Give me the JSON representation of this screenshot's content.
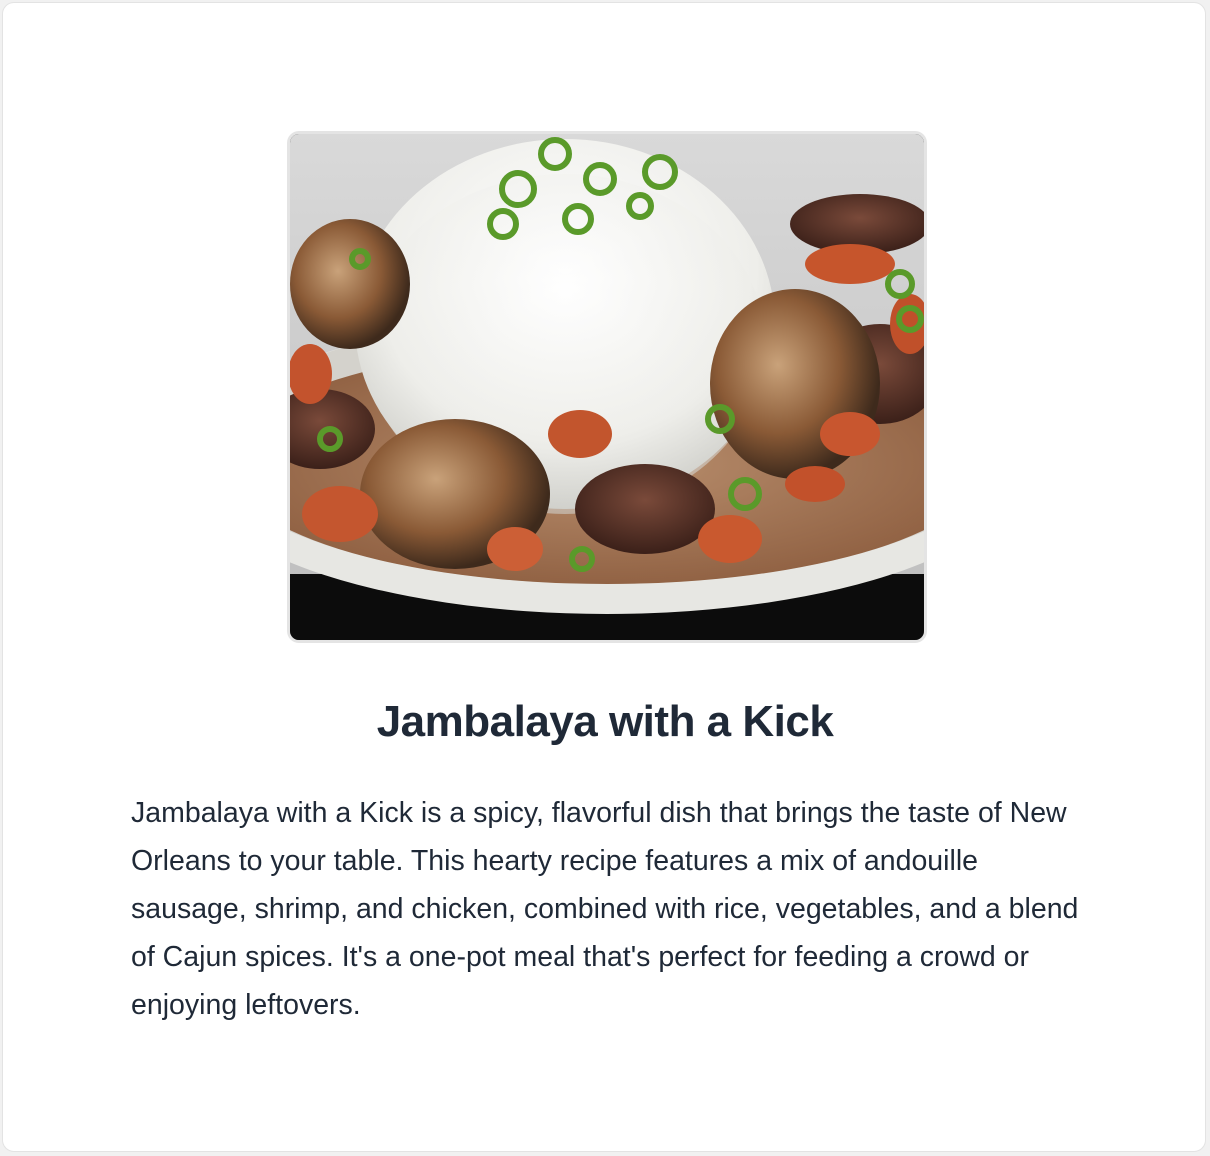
{
  "recipe": {
    "image": {
      "alt": "Jambalaya with a Kick",
      "subject": "plate of white rice dome with seared shrimp, crawfish, andouille sausage slices, green onions and creamy sauce",
      "icon": "food-photo"
    },
    "title": "Jambalaya with a Kick",
    "description": "Jambalaya with a Kick is a spicy, flavorful dish that brings the taste of New Orleans to your table. This hearty recipe features a mix of andouille sausage, shrimp, and chicken, combined with rice, vegetables, and a blend of Cajun spices. It's a one-pot meal that's perfect for feeding a crowd or enjoying leftovers."
  },
  "colors": {
    "title_text": "#1f2937",
    "body_text": "#1f2937",
    "card_background": "#ffffff",
    "page_background": "#f1f1f1"
  }
}
